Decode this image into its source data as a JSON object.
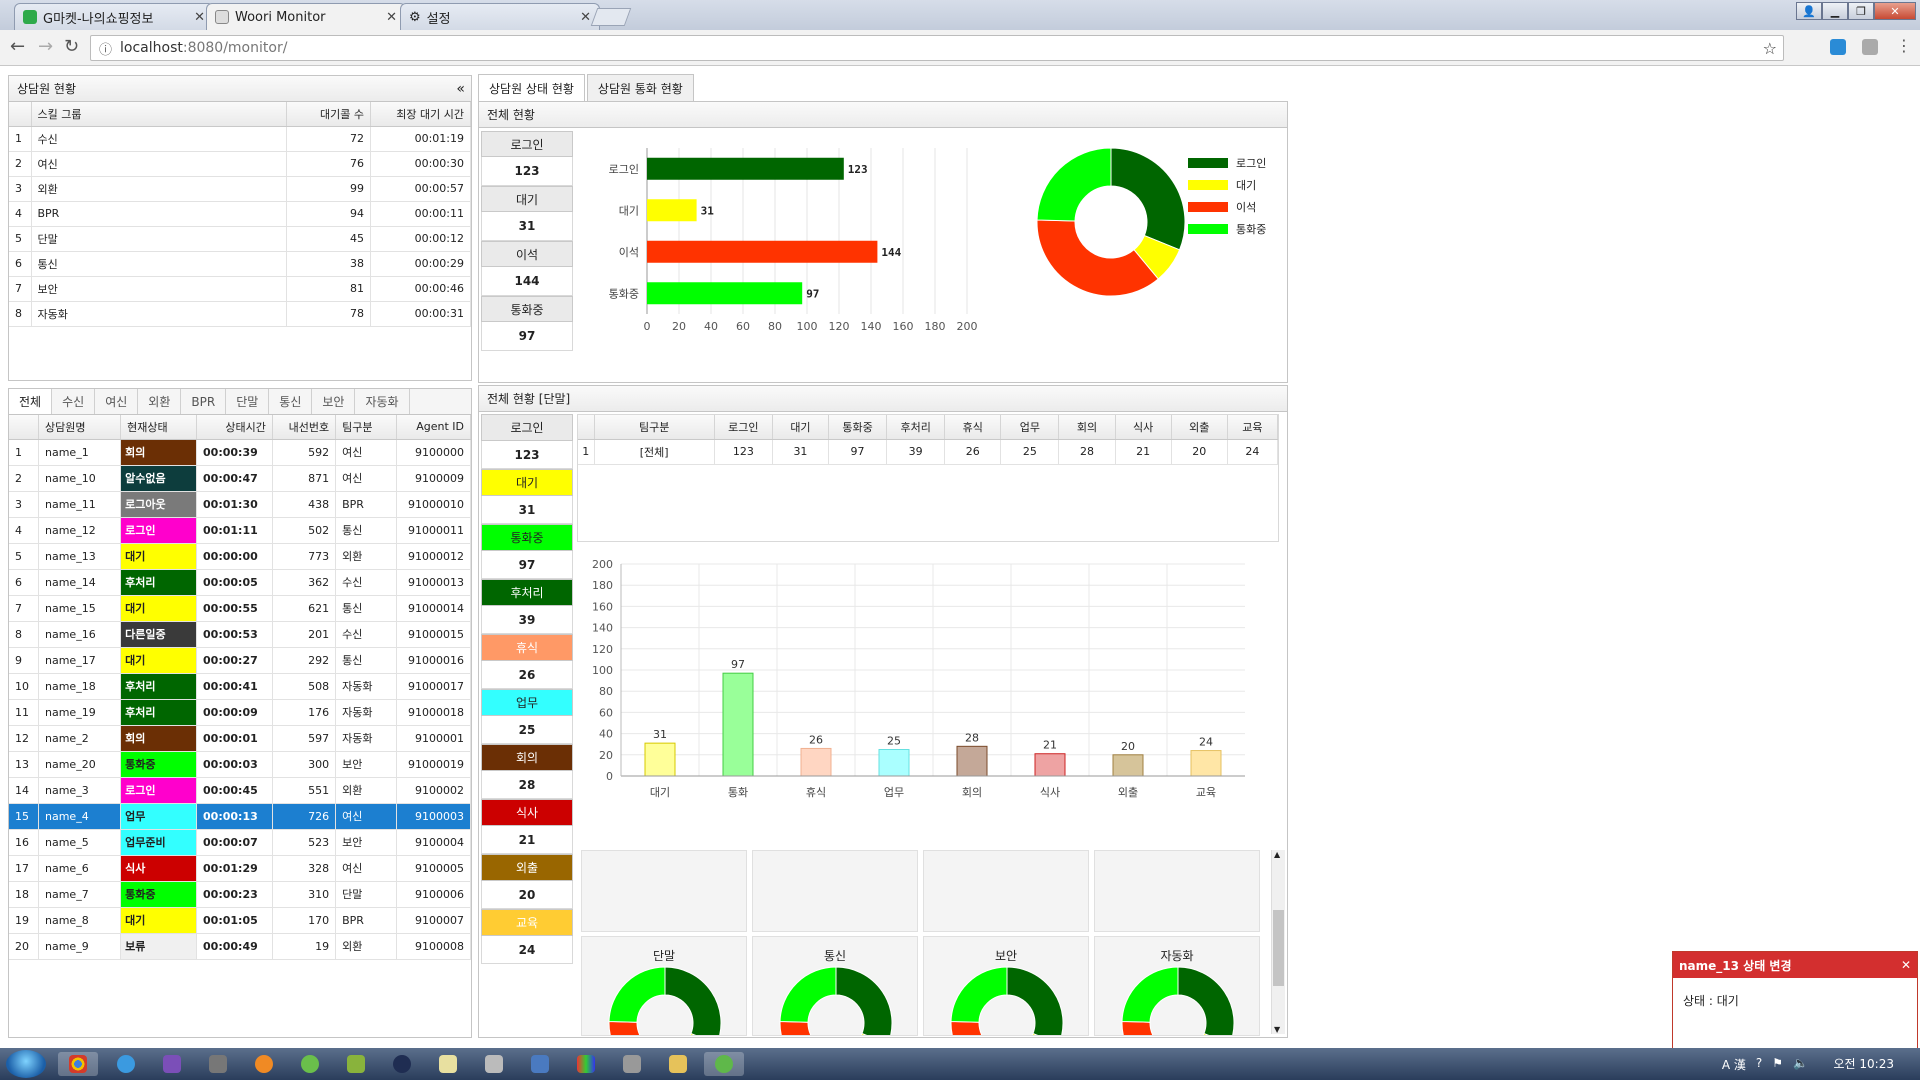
{
  "browser": {
    "tabs": [
      {
        "label": "G마켓-나의쇼핑정보",
        "icon": "google-icon",
        "active": false
      },
      {
        "label": "Woori Monitor",
        "icon": "page-icon",
        "active": true
      },
      {
        "label": "설정",
        "icon": "gear-icon",
        "active": false
      }
    ],
    "url_host": "localhost",
    "url_rest": ":8080/monitor/"
  },
  "skill": {
    "title": "상담원 현황",
    "columns": [
      "",
      "스킬 그룹",
      "대기콜 수",
      "최장 대기 시간"
    ],
    "rows": [
      [
        "1",
        "수신",
        "72",
        "00:01:19"
      ],
      [
        "2",
        "여신",
        "76",
        "00:00:30"
      ],
      [
        "3",
        "외환",
        "99",
        "00:00:57"
      ],
      [
        "4",
        "BPR",
        "94",
        "00:00:11"
      ],
      [
        "5",
        "단말",
        "45",
        "00:00:12"
      ],
      [
        "6",
        "통신",
        "38",
        "00:00:29"
      ],
      [
        "7",
        "보안",
        "81",
        "00:00:46"
      ],
      [
        "8",
        "자동화",
        "78",
        "00:00:31"
      ]
    ]
  },
  "agent_tabs": [
    "전체",
    "수신",
    "여신",
    "외환",
    "BPR",
    "단말",
    "통신",
    "보안",
    "자동화"
  ],
  "agents": {
    "columns": [
      "",
      "상담원명",
      "현재상태",
      "상태시간",
      "내선번호",
      "팀구분",
      "Agent ID"
    ],
    "rows": [
      [
        "1",
        "name_1",
        "회의",
        "00:00:39",
        "592",
        "여신",
        "9100000"
      ],
      [
        "2",
        "name_10",
        "알수없음",
        "00:00:47",
        "871",
        "여신",
        "9100009"
      ],
      [
        "3",
        "name_11",
        "로그아웃",
        "00:01:30",
        "438",
        "BPR",
        "91000010"
      ],
      [
        "4",
        "name_12",
        "로그인",
        "00:01:11",
        "502",
        "통신",
        "91000011"
      ],
      [
        "5",
        "name_13",
        "대기",
        "00:00:00",
        "773",
        "외환",
        "91000012"
      ],
      [
        "6",
        "name_14",
        "후처리",
        "00:00:05",
        "362",
        "수신",
        "91000013"
      ],
      [
        "7",
        "name_15",
        "대기",
        "00:00:55",
        "621",
        "통신",
        "91000014"
      ],
      [
        "8",
        "name_16",
        "다른일중",
        "00:00:53",
        "201",
        "수신",
        "91000015"
      ],
      [
        "9",
        "name_17",
        "대기",
        "00:00:27",
        "292",
        "통신",
        "91000016"
      ],
      [
        "10",
        "name_18",
        "후처리",
        "00:00:41",
        "508",
        "자동화",
        "91000017"
      ],
      [
        "11",
        "name_19",
        "후처리",
        "00:00:09",
        "176",
        "자동화",
        "91000018"
      ],
      [
        "12",
        "name_2",
        "회의",
        "00:00:01",
        "597",
        "자동화",
        "9100001"
      ],
      [
        "13",
        "name_20",
        "통화중",
        "00:00:03",
        "300",
        "보안",
        "91000019"
      ],
      [
        "14",
        "name_3",
        "로그인",
        "00:00:45",
        "551",
        "외환",
        "9100002"
      ],
      [
        "15",
        "name_4",
        "업무",
        "00:00:13",
        "726",
        "여신",
        "9100003"
      ],
      [
        "16",
        "name_5",
        "업무준비",
        "00:00:07",
        "523",
        "보안",
        "9100004"
      ],
      [
        "17",
        "name_6",
        "식사",
        "00:01:29",
        "328",
        "여신",
        "9100005"
      ],
      [
        "18",
        "name_7",
        "통화중",
        "00:00:23",
        "310",
        "단말",
        "9100006"
      ],
      [
        "19",
        "name_8",
        "대기",
        "00:01:05",
        "170",
        "BPR",
        "9100007"
      ],
      [
        "20",
        "name_9",
        "보류",
        "00:00:49",
        "19",
        "외환",
        "9100008"
      ]
    ],
    "selected_index": 14
  },
  "status_colors": {
    "회의": {
      "bg": "#6b2f05",
      "fg": "#ffffff"
    },
    "알수없음": {
      "bg": "#0d3d3d",
      "fg": "#ffffff"
    },
    "로그아웃": {
      "bg": "#7a7a7a",
      "fg": "#ffffff"
    },
    "로그인": {
      "bg": "#ff00cc",
      "fg": "#ffffff"
    },
    "대기": {
      "bg": "#ffff00",
      "fg": "#222222"
    },
    "후처리": {
      "bg": "#006600",
      "fg": "#ffffff"
    },
    "다른일중": {
      "bg": "#3a3a3a",
      "fg": "#ffffff"
    },
    "통화중": {
      "bg": "#00ff00",
      "fg": "#222222"
    },
    "업무": {
      "bg": "#33ffff",
      "fg": "#222222"
    },
    "업무준비": {
      "bg": "#33ffff",
      "fg": "#222222"
    },
    "식사": {
      "bg": "#cc0000",
      "fg": "#ffffff"
    },
    "보류": {
      "bg": "#f0f0f0",
      "fg": "#222222"
    }
  },
  "right_tabs": [
    "상담원 상태 현황",
    "상담원 통화 현황"
  ],
  "overall": {
    "title": "전체 현황",
    "items": [
      {
        "label": "로그인",
        "value": "123"
      },
      {
        "label": "대기",
        "value": "31"
      },
      {
        "label": "이석",
        "value": "144"
      },
      {
        "label": "통화중",
        "value": "97"
      }
    ]
  },
  "terminal": {
    "title": "전체 현황 [단말]",
    "items": [
      {
        "label": "로그인",
        "value": "123",
        "bg": "#eaeaea",
        "fg": "#222222"
      },
      {
        "label": "대기",
        "value": "31",
        "bg": "#ffff00",
        "fg": "#222222"
      },
      {
        "label": "통화중",
        "value": "97",
        "bg": "#00ff00",
        "fg": "#222222"
      },
      {
        "label": "후처리",
        "value": "39",
        "bg": "#006600",
        "fg": "#ffffff"
      },
      {
        "label": "휴식",
        "value": "26",
        "bg": "#ff9966",
        "fg": "#ffffff"
      },
      {
        "label": "업무",
        "value": "25",
        "bg": "#33ffff",
        "fg": "#222222"
      },
      {
        "label": "회의",
        "value": "28",
        "bg": "#6b2f05",
        "fg": "#ffffff"
      },
      {
        "label": "식사",
        "value": "21",
        "bg": "#cc0000",
        "fg": "#ffffff"
      },
      {
        "label": "외출",
        "value": "20",
        "bg": "#996600",
        "fg": "#ffffff"
      },
      {
        "label": "교육",
        "value": "24",
        "bg": "#ffcc33",
        "fg": "#ffffff"
      }
    ],
    "table": {
      "columns": [
        "",
        "팀구분",
        "로그인",
        "대기",
        "통화중",
        "후처리",
        "휴식",
        "업무",
        "회의",
        "식사",
        "외출",
        "교육"
      ],
      "rows": [
        [
          "1",
          "[전체]",
          "123",
          "31",
          "97",
          "39",
          "26",
          "25",
          "28",
          "21",
          "20",
          "24"
        ]
      ]
    },
    "mini_labels": [
      "단말",
      "통신",
      "보안",
      "자동화"
    ]
  },
  "chart_data": [
    {
      "type": "bar",
      "orientation": "horizontal",
      "categories": [
        "로그인",
        "대기",
        "이석",
        "통화중"
      ],
      "values": [
        123,
        31,
        144,
        97
      ],
      "colors": [
        "#006600",
        "#ffff00",
        "#ff3300",
        "#00ff00"
      ],
      "xlim": [
        0,
        200
      ],
      "xticks": [
        0,
        20,
        40,
        60,
        80,
        100,
        120,
        140,
        160,
        180,
        200
      ],
      "grid": true
    },
    {
      "type": "pie",
      "donut": true,
      "labels": [
        "로그인",
        "대기",
        "이석",
        "통화중"
      ],
      "values": [
        123,
        31,
        144,
        97
      ],
      "colors": [
        "#006600",
        "#ffff00",
        "#ff3300",
        "#00ff00"
      ],
      "legend": "right"
    },
    {
      "type": "bar",
      "orientation": "vertical",
      "categories": [
        "대기",
        "통화",
        "휴식",
        "업무",
        "회의",
        "식사",
        "외출",
        "교육"
      ],
      "values": [
        31,
        97,
        26,
        25,
        28,
        21,
        20,
        24
      ],
      "fill_colors": [
        "#ffff99",
        "#99ff99",
        "#ffd6c2",
        "#aaffff",
        "#c4a898",
        "#eea3a3",
        "#d6c49a",
        "#ffe6a6"
      ],
      "stroke_colors": [
        "#d6c800",
        "#44cc44",
        "#f0b090",
        "#66e0e0",
        "#7a4a2a",
        "#cc2222",
        "#a08040",
        "#e6c060"
      ],
      "ylim": [
        0,
        200
      ],
      "yticks": [
        0,
        20,
        40,
        60,
        80,
        100,
        120,
        140,
        160,
        180,
        200
      ],
      "grid": true
    }
  ],
  "notification": {
    "title": "name_13 상태 변경",
    "body": "상태 : 대기"
  },
  "taskbar": {
    "clock": "오전 10:23",
    "ime": "A 漢"
  }
}
